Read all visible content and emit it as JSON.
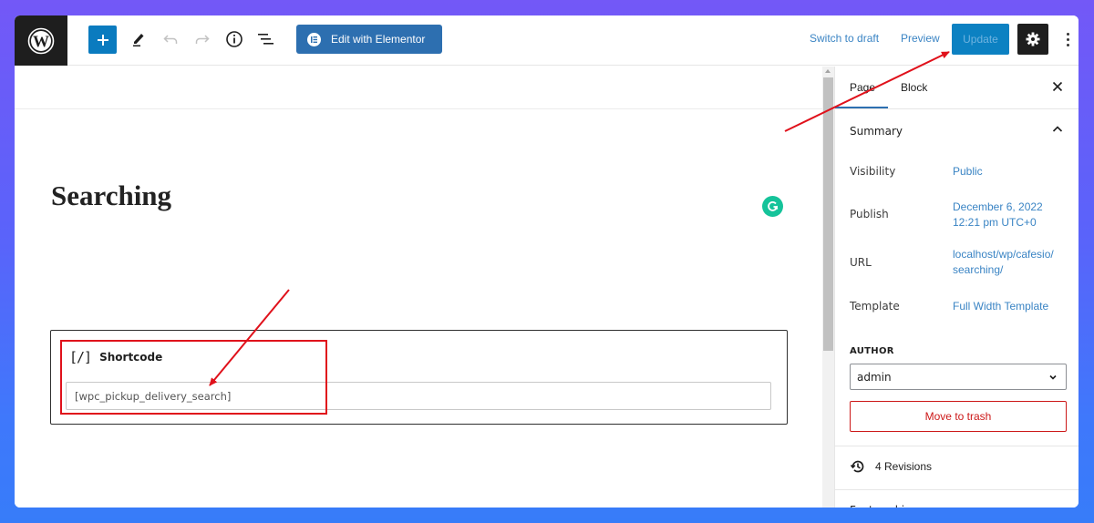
{
  "toolbar": {
    "logo_icon": "wordpress-logo-icon",
    "add_block_icon": "plus-icon",
    "tools_icon": "pencil-icon",
    "undo_icon": "undo-icon",
    "redo_icon": "redo-icon",
    "details_icon": "info-icon",
    "list_view_icon": "list-view-icon",
    "edit_with_elementor": "Edit with Elementor",
    "switch_to_draft": "Switch to draft",
    "preview": "Preview",
    "update": "Update",
    "settings_icon": "gear-icon",
    "more_icon": "vertical-ellipsis-icon"
  },
  "editor": {
    "page_title": "Searching",
    "grammarly_icon": "grammarly-icon",
    "shortcode_block": {
      "icon": "[/]",
      "label": "Shortcode",
      "value": "[wpc_pickup_delivery_search]"
    }
  },
  "sidebar": {
    "tabs": [
      {
        "label": "Page",
        "active": true
      },
      {
        "label": "Block",
        "active": false
      }
    ],
    "summary": {
      "title": "Summary",
      "rows": [
        {
          "label": "Visibility",
          "value": "Public"
        },
        {
          "label": "Publish",
          "value_line1": "December 6, 2022",
          "value_line2": "12:21 pm UTC+0"
        },
        {
          "label": "URL",
          "value_line1": "localhost/wp/cafesio/",
          "value_line2": "searching/"
        },
        {
          "label": "Template",
          "value": "Full Width Template"
        }
      ],
      "author_label": "AUTHOR",
      "author_value": "admin",
      "move_to_trash": "Move to trash"
    },
    "revisions": "4 Revisions",
    "featured_image": "Featured image"
  },
  "colors": {
    "accent": "#0a7bbf",
    "elementor": "#2d6fb0",
    "link": "#3a84c4",
    "danger": "#cc1818",
    "annotation_red": "#e0111b",
    "grammarly": "#15c39a"
  }
}
